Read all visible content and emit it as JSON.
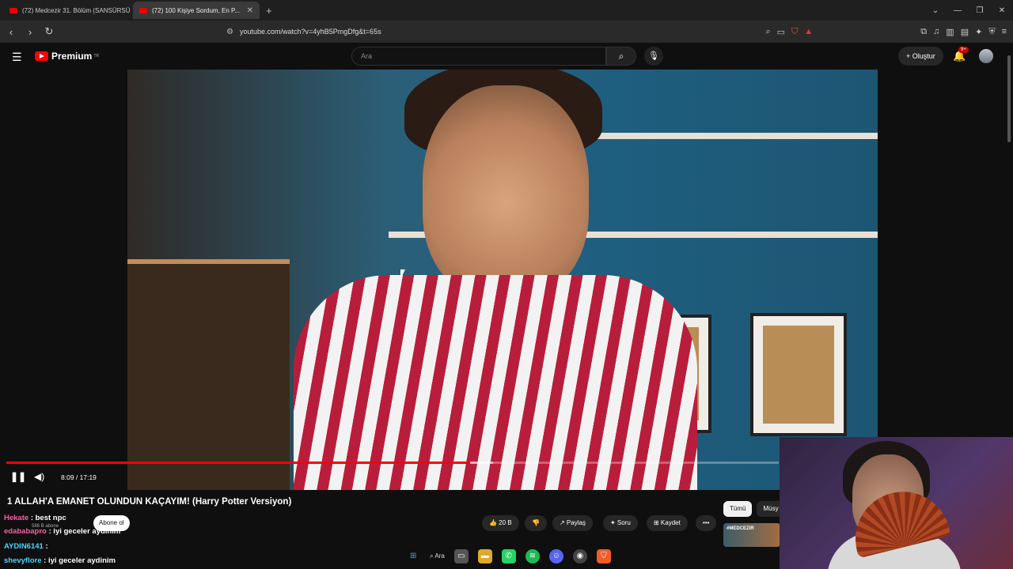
{
  "tabs": [
    {
      "title": "(72) Medcezir 31. Bölüm (SANSÜRSÜ",
      "close": ""
    },
    {
      "title": "(72) 100 Kişiye Sordum, En P...",
      "close": "✕"
    }
  ],
  "new_tab": "+",
  "window_controls": [
    "⌄",
    "—",
    "❐",
    "✕"
  ],
  "address": {
    "url": "youtube.com/watch?v=4yhB5PmgDfg&t=65s",
    "back": "‹",
    "forward": "›",
    "reload": "↻",
    "bookmark": "🔖"
  },
  "youtube": {
    "logo": "Premium",
    "logo_region": "TR",
    "search_placeholder": "Ara",
    "create_label": "+ Oluştur",
    "notifications_badge": "9+"
  },
  "player": {
    "current_time": "8:09",
    "duration": "17:19",
    "time_label": "8:09 / 17:19",
    "progress_percent": 0.6,
    "buffered_percent": 0.63
  },
  "video": {
    "title": "1 ALLAH'A EMANET OLUNDUN KAÇAYIM! (Harry Potter Versiyon)",
    "channel_subs": "586 B abone",
    "subscribe_label": "Abone ol",
    "likes": "👍 20 B",
    "dislike": "👎",
    "share": "↗ Paylaş",
    "ask": "✦ Soru",
    "save": "⊞ Kaydet",
    "more": "•••"
  },
  "chips": [
    "Tümü",
    "Müsy"
  ],
  "thumb_label": "#MEDCEZIR",
  "chat": [
    {
      "user": "Hekate",
      "text": ": best npc",
      "color": "pink"
    },
    {
      "user": "edababapro",
      "text": ": iyi geceler aydinim",
      "color": "pink"
    },
    {
      "user": "AYDIN6141",
      "text": ":",
      "color": "cyan"
    },
    {
      "user": "shevyflore",
      "text": ": iyi geceler aydinim",
      "color": "cyan"
    }
  ],
  "taskbar": {
    "search": "Ara"
  }
}
